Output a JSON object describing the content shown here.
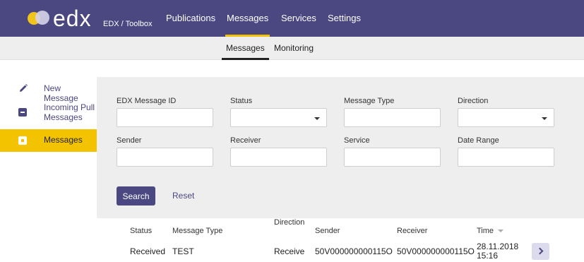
{
  "brand": {
    "logo_text": "edx",
    "subtitle": "EDX / Toolbox",
    "accent": "#f3c300",
    "primary": "#4b4781"
  },
  "nav": {
    "items": [
      {
        "label": "Publications",
        "active": false
      },
      {
        "label": "Messages",
        "active": true
      },
      {
        "label": "Services",
        "active": false
      },
      {
        "label": "Settings",
        "active": false
      }
    ]
  },
  "subnav": {
    "items": [
      {
        "label": "Messages",
        "active": true
      },
      {
        "label": "Monitoring",
        "active": false
      }
    ]
  },
  "sidebar": {
    "items": [
      {
        "label": "New Message",
        "icon": "pencil-icon",
        "active": false
      },
      {
        "label_line1": "Incoming Pull",
        "label_line2": "Messages",
        "icon": "inbox-icon",
        "active": false
      },
      {
        "label": "Messages",
        "icon": "messages-icon",
        "active": true
      }
    ]
  },
  "filters": {
    "edx_message_id": {
      "label": "EDX Message ID",
      "value": ""
    },
    "status": {
      "label": "Status",
      "value": ""
    },
    "message_type": {
      "label": "Message Type",
      "value": ""
    },
    "direction": {
      "label": "Direction",
      "value": ""
    },
    "sender": {
      "label": "Sender",
      "value": ""
    },
    "receiver": {
      "label": "Receiver",
      "value": ""
    },
    "service": {
      "label": "Service",
      "value": ""
    },
    "date_range": {
      "label": "Date Range",
      "value": ""
    }
  },
  "actions": {
    "search_label": "Search",
    "reset_label": "Reset"
  },
  "table": {
    "headers": {
      "status": "Status",
      "message_type": "Message Type",
      "direction": "Direction",
      "sender": "Sender",
      "receiver": "Receiver",
      "time": "Time"
    },
    "rows": [
      {
        "status": "Received",
        "message_type": "TEST",
        "direction": "Receive",
        "sender": "50V000000000115O",
        "receiver": "50V000000000115O",
        "time_date": "28.11.2018",
        "time_clock": "15:16"
      }
    ]
  }
}
